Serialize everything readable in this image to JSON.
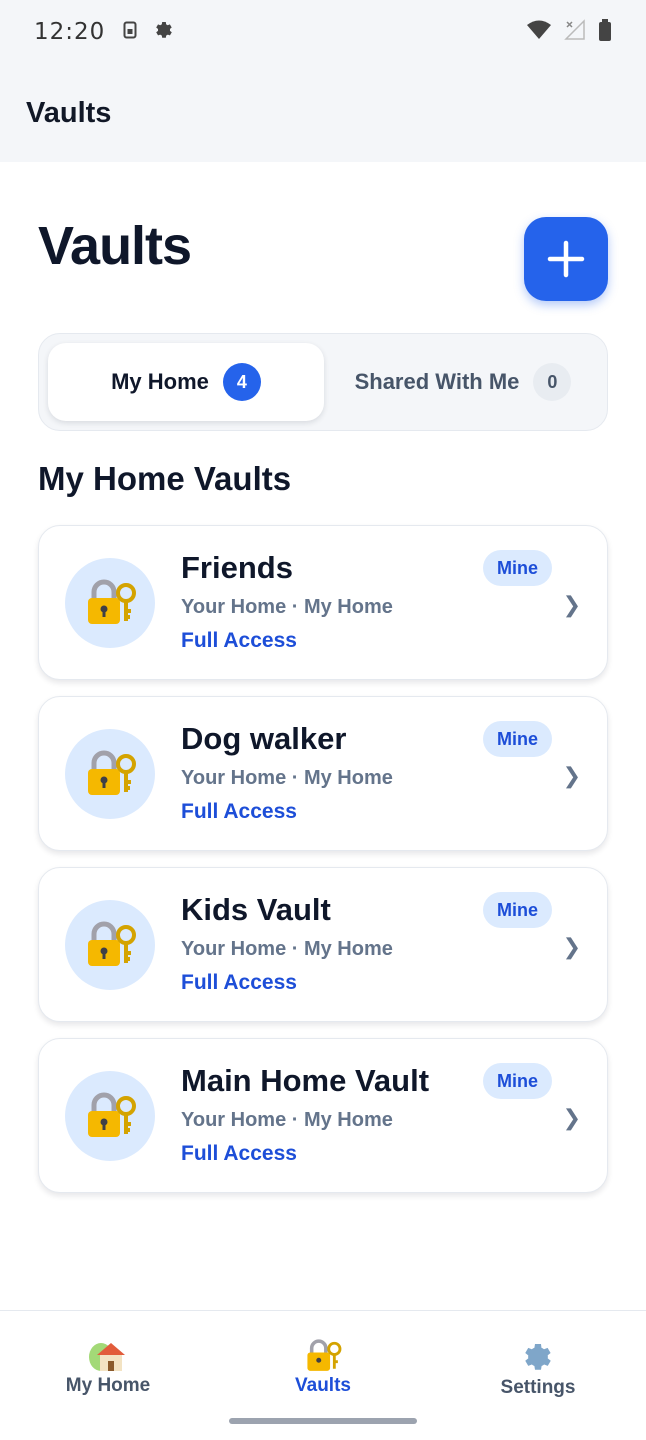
{
  "status_bar": {
    "time": "12:20",
    "left_icons": [
      "sim-card-icon",
      "gear-icon"
    ],
    "right_icons": [
      "wifi-icon",
      "signal-icon",
      "battery-icon"
    ]
  },
  "app_bar": {
    "title": "Vaults"
  },
  "page": {
    "title": "Vaults",
    "add_icon": "plus-icon"
  },
  "tabs": [
    {
      "label": "My Home",
      "count": "4",
      "active": true
    },
    {
      "label": "Shared With Me",
      "count": "0",
      "active": false
    }
  ],
  "section_title": "My Home Vaults",
  "vaults": [
    {
      "name": "Friends",
      "location": "Your Home · My Home",
      "access": "Full Access",
      "badge": "Mine",
      "icon": "lock-with-key-icon"
    },
    {
      "name": "Dog walker",
      "location": "Your Home · My Home",
      "access": "Full Access",
      "badge": "Mine",
      "icon": "lock-with-key-icon"
    },
    {
      "name": "Kids Vault",
      "location": "Your Home · My Home",
      "access": "Full Access",
      "badge": "Mine",
      "icon": "lock-with-key-icon"
    },
    {
      "name": "Main Home Vault",
      "location": "Your Home · My Home",
      "access": "Full Access",
      "badge": "Mine",
      "icon": "lock-with-key-icon"
    }
  ],
  "chevron": "❯",
  "bottom_nav": [
    {
      "label": "My Home",
      "icon": "house-icon",
      "active": false
    },
    {
      "label": "Vaults",
      "icon": "lock-with-key-icon",
      "active": true
    },
    {
      "label": "Settings",
      "icon": "gear-icon",
      "active": false
    }
  ],
  "colors": {
    "accent": "#2563eb",
    "accent_text": "#1d4ed8",
    "badge_bg": "#dbeafe",
    "header_bg": "#f4f6f9"
  }
}
